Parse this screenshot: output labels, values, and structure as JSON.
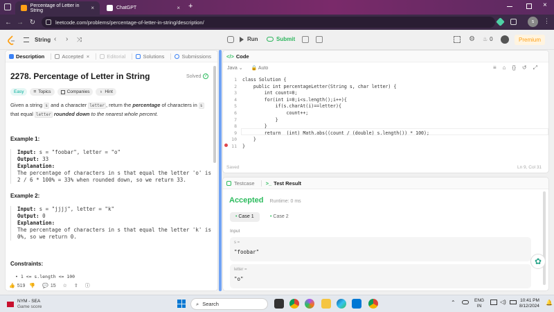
{
  "browser": {
    "tabs": [
      {
        "title": "Percentage of Letter in String",
        "close": "×"
      },
      {
        "title": "ChatGPT",
        "close": "×"
      }
    ],
    "new_tab": "+",
    "url": "leetcode.com/problems/percentage-of-letter-in-string/description/"
  },
  "toolbar": {
    "problem_list": "String",
    "run": "Run",
    "submit": "Submit",
    "streak": "0",
    "premium": "Premium"
  },
  "left_tabs": {
    "description": "Description",
    "accepted": "Accepted",
    "editorial": "Editorial",
    "solutions": "Solutions",
    "submissions": "Submissions"
  },
  "problem": {
    "title": "2278. Percentage of Letter in String",
    "status": "Solved",
    "difficulty": "Easy",
    "topics": "Topics",
    "companies": "Companies",
    "hint": "Hint",
    "desc_1": "Given a string",
    "desc_s": "s",
    "desc_2": "and a character",
    "desc_letter": "letter",
    "desc_3": ", return the",
    "desc_bold": "percentage",
    "desc_4": "of characters in",
    "desc_5": "that",
    "desc_6": "equal",
    "desc_bold2": "rounded down",
    "desc_7": "to the nearest whole percent.",
    "example1_title": "Example 1:",
    "example1_input_label": "Input:",
    "example1_input": "s = \"foobar\", letter = \"o\"",
    "example1_output_label": "Output:",
    "example1_output": "33",
    "example1_expl_label": "Explanation:",
    "example1_expl_1": "The percentage of characters in s that equal the letter 'o' is",
    "example1_expl_2": "2 / 6 * 100% = 33% when rounded down, so we return 33.",
    "example2_title": "Example 2:",
    "example2_input_label": "Input:",
    "example2_input": "s = \"jjjj\", letter = \"k\"",
    "example2_output_label": "Output:",
    "example2_output": "0",
    "example2_expl_label": "Explanation:",
    "example2_expl_1": "The percentage of characters in s that equal the letter 'k' is",
    "example2_expl_2": "0%, so we return 0.",
    "constraints_title": "Constraints:",
    "constraint_1": "1 <= s.length <= 100",
    "likes": "519",
    "comments": "15"
  },
  "editor": {
    "title": "Code",
    "language": "Java",
    "autocomplete": "Auto",
    "lines": [
      {
        "n": "1",
        "t": "class Solution {"
      },
      {
        "n": "2",
        "t": "    public int percentageLetter(String s, char letter) {"
      },
      {
        "n": "3",
        "t": "        int count=0;"
      },
      {
        "n": "4",
        "t": "        for(int i=0;i<s.length();i++){"
      },
      {
        "n": "5",
        "t": "            if(s.charAt(i)==letter){"
      },
      {
        "n": "6",
        "t": "                count++;"
      },
      {
        "n": "7",
        "t": "            }"
      },
      {
        "n": "8",
        "t": "        }"
      },
      {
        "n": "9",
        "t": "        return  (int) Math.abs((count / (double) s.length()) * 100);"
      },
      {
        "n": "10",
        "t": "    }"
      },
      {
        "n": "11",
        "t": "}"
      }
    ],
    "saved": "Saved",
    "cursor": "Ln 9, Col 31"
  },
  "tests": {
    "testcase_tab": "Testcase",
    "result_tab": "Test Result",
    "verdict": "Accepted",
    "runtime": "Runtime: 0 ms",
    "case1": "Case 1",
    "case2": "Case 2",
    "input_label": "Input",
    "var1_name": "s =",
    "var1_value": "\"foobar\"",
    "var2_name": "letter =",
    "var2_value": "\"o\""
  },
  "taskbar": {
    "weather_title": "NYM - SEA",
    "weather_sub": "Game score",
    "search": "Search",
    "lang_1": "ENG",
    "lang_2": "IN",
    "time": "10:41 PM",
    "date": "8/12/2024"
  },
  "colors": {
    "accent_green": "#2db55d",
    "accepted_green": "#2cbb5d",
    "premium_orange": "#ffa116",
    "browser_purple": "#3d2a48"
  }
}
